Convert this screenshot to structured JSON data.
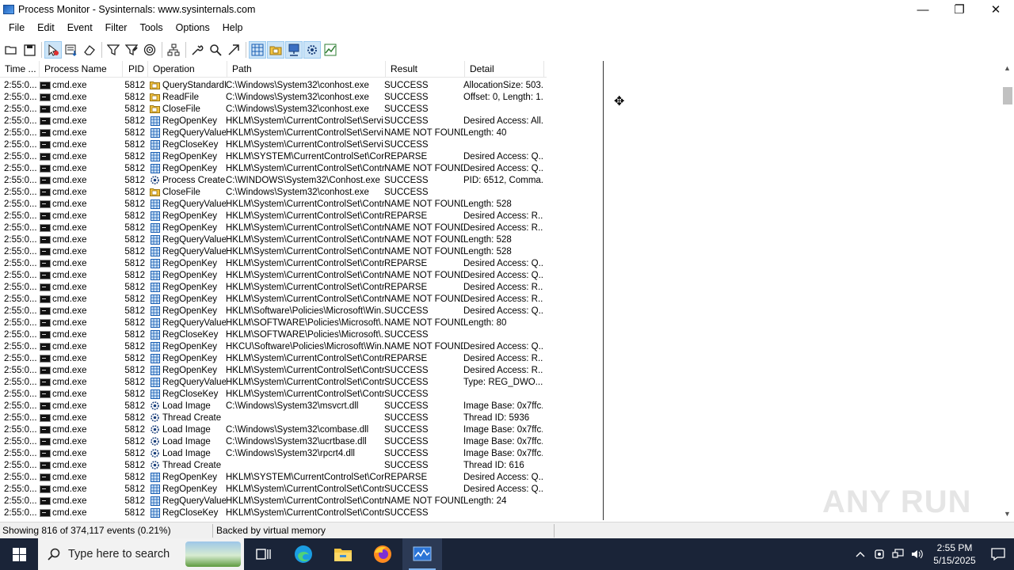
{
  "window": {
    "title": "Process Monitor - Sysinternals: www.sysinternals.com",
    "minimize": "—",
    "maximize": "❐",
    "close": "✕"
  },
  "menu": [
    "File",
    "Edit",
    "Event",
    "Filter",
    "Tools",
    "Options",
    "Help"
  ],
  "columns": [
    "Time ...",
    "Process Name",
    "PID",
    "Operation",
    "Path",
    "Result",
    "Detail"
  ],
  "events": [
    {
      "time": "2:55:0...",
      "process": "cmd.exe",
      "pid": "5812",
      "op_icon": "folder-icon",
      "operation": "QueryStandardI...",
      "path": "C:\\Windows\\System32\\conhost.exe",
      "result": "SUCCESS",
      "detail": "AllocationSize: 503..."
    },
    {
      "time": "2:55:0...",
      "process": "cmd.exe",
      "pid": "5812",
      "op_icon": "folder-icon",
      "operation": "ReadFile",
      "path": "C:\\Windows\\System32\\conhost.exe",
      "result": "SUCCESS",
      "detail": "Offset: 0, Length: 1..."
    },
    {
      "time": "2:55:0...",
      "process": "cmd.exe",
      "pid": "5812",
      "op_icon": "folder-icon",
      "operation": "CloseFile",
      "path": "C:\\Windows\\System32\\conhost.exe",
      "result": "SUCCESS",
      "detail": ""
    },
    {
      "time": "2:55:0...",
      "process": "cmd.exe",
      "pid": "5812",
      "op_icon": "registry-icon",
      "operation": "RegOpenKey",
      "path": "HKLM\\System\\CurrentControlSet\\Servi...",
      "result": "SUCCESS",
      "detail": "Desired Access: All..."
    },
    {
      "time": "2:55:0...",
      "process": "cmd.exe",
      "pid": "5812",
      "op_icon": "registry-icon",
      "operation": "RegQueryValue",
      "path": "HKLM\\System\\CurrentControlSet\\Servi...",
      "result": "NAME NOT FOUND",
      "detail": "Length: 40"
    },
    {
      "time": "2:55:0...",
      "process": "cmd.exe",
      "pid": "5812",
      "op_icon": "registry-icon",
      "operation": "RegCloseKey",
      "path": "HKLM\\System\\CurrentControlSet\\Servi...",
      "result": "SUCCESS",
      "detail": ""
    },
    {
      "time": "2:55:0...",
      "process": "cmd.exe",
      "pid": "5812",
      "op_icon": "registry-icon",
      "operation": "RegOpenKey",
      "path": "HKLM\\SYSTEM\\CurrentControlSet\\Con...",
      "result": "REPARSE",
      "detail": "Desired Access: Q..."
    },
    {
      "time": "2:55:0...",
      "process": "cmd.exe",
      "pid": "5812",
      "op_icon": "registry-icon",
      "operation": "RegOpenKey",
      "path": "HKLM\\System\\CurrentControlSet\\Contr...",
      "result": "NAME NOT FOUND",
      "detail": "Desired Access: Q..."
    },
    {
      "time": "2:55:0...",
      "process": "cmd.exe",
      "pid": "5812",
      "op_icon": "process-icon",
      "operation": "Process Create",
      "path": "C:\\WINDOWS\\System32\\Conhost.exe",
      "result": "SUCCESS",
      "detail": "PID: 6512, Comma..."
    },
    {
      "time": "2:55:0...",
      "process": "cmd.exe",
      "pid": "5812",
      "op_icon": "folder-icon",
      "operation": "CloseFile",
      "path": "C:\\Windows\\System32\\conhost.exe",
      "result": "SUCCESS",
      "detail": ""
    },
    {
      "time": "2:55:0...",
      "process": "cmd.exe",
      "pid": "5812",
      "op_icon": "registry-icon",
      "operation": "RegQueryValue",
      "path": "HKLM\\System\\CurrentControlSet\\Contr...",
      "result": "NAME NOT FOUND",
      "detail": "Length: 528"
    },
    {
      "time": "2:55:0...",
      "process": "cmd.exe",
      "pid": "5812",
      "op_icon": "registry-icon",
      "operation": "RegOpenKey",
      "path": "HKLM\\System\\CurrentControlSet\\Contr...",
      "result": "REPARSE",
      "detail": "Desired Access: R..."
    },
    {
      "time": "2:55:0...",
      "process": "cmd.exe",
      "pid": "5812",
      "op_icon": "registry-icon",
      "operation": "RegOpenKey",
      "path": "HKLM\\System\\CurrentControlSet\\Contr...",
      "result": "NAME NOT FOUND",
      "detail": "Desired Access: R..."
    },
    {
      "time": "2:55:0...",
      "process": "cmd.exe",
      "pid": "5812",
      "op_icon": "registry-icon",
      "operation": "RegQueryValue",
      "path": "HKLM\\System\\CurrentControlSet\\Contr...",
      "result": "NAME NOT FOUND",
      "detail": "Length: 528"
    },
    {
      "time": "2:55:0...",
      "process": "cmd.exe",
      "pid": "5812",
      "op_icon": "registry-icon",
      "operation": "RegQueryValue",
      "path": "HKLM\\System\\CurrentControlSet\\Contr...",
      "result": "NAME NOT FOUND",
      "detail": "Length: 528"
    },
    {
      "time": "2:55:0...",
      "process": "cmd.exe",
      "pid": "5812",
      "op_icon": "registry-icon",
      "operation": "RegOpenKey",
      "path": "HKLM\\System\\CurrentControlSet\\Contr...",
      "result": "REPARSE",
      "detail": "Desired Access: Q..."
    },
    {
      "time": "2:55:0...",
      "process": "cmd.exe",
      "pid": "5812",
      "op_icon": "registry-icon",
      "operation": "RegOpenKey",
      "path": "HKLM\\System\\CurrentControlSet\\Contr...",
      "result": "NAME NOT FOUND",
      "detail": "Desired Access: Q..."
    },
    {
      "time": "2:55:0...",
      "process": "cmd.exe",
      "pid": "5812",
      "op_icon": "registry-icon",
      "operation": "RegOpenKey",
      "path": "HKLM\\System\\CurrentControlSet\\Contr...",
      "result": "REPARSE",
      "detail": "Desired Access: R..."
    },
    {
      "time": "2:55:0...",
      "process": "cmd.exe",
      "pid": "5812",
      "op_icon": "registry-icon",
      "operation": "RegOpenKey",
      "path": "HKLM\\System\\CurrentControlSet\\Contr...",
      "result": "NAME NOT FOUND",
      "detail": "Desired Access: R..."
    },
    {
      "time": "2:55:0...",
      "process": "cmd.exe",
      "pid": "5812",
      "op_icon": "registry-icon",
      "operation": "RegOpenKey",
      "path": "HKLM\\Software\\Policies\\Microsoft\\Win...",
      "result": "SUCCESS",
      "detail": "Desired Access: Q..."
    },
    {
      "time": "2:55:0...",
      "process": "cmd.exe",
      "pid": "5812",
      "op_icon": "registry-icon",
      "operation": "RegQueryValue",
      "path": "HKLM\\SOFTWARE\\Policies\\Microsoft\\...",
      "result": "NAME NOT FOUND",
      "detail": "Length: 80"
    },
    {
      "time": "2:55:0...",
      "process": "cmd.exe",
      "pid": "5812",
      "op_icon": "registry-icon",
      "operation": "RegCloseKey",
      "path": "HKLM\\SOFTWARE\\Policies\\Microsoft\\...",
      "result": "SUCCESS",
      "detail": ""
    },
    {
      "time": "2:55:0...",
      "process": "cmd.exe",
      "pid": "5812",
      "op_icon": "registry-icon",
      "operation": "RegOpenKey",
      "path": "HKCU\\Software\\Policies\\Microsoft\\Win...",
      "result": "NAME NOT FOUND",
      "detail": "Desired Access: Q..."
    },
    {
      "time": "2:55:0...",
      "process": "cmd.exe",
      "pid": "5812",
      "op_icon": "registry-icon",
      "operation": "RegOpenKey",
      "path": "HKLM\\System\\CurrentControlSet\\Contr...",
      "result": "REPARSE",
      "detail": "Desired Access: R..."
    },
    {
      "time": "2:55:0...",
      "process": "cmd.exe",
      "pid": "5812",
      "op_icon": "registry-icon",
      "operation": "RegOpenKey",
      "path": "HKLM\\System\\CurrentControlSet\\Contr...",
      "result": "SUCCESS",
      "detail": "Desired Access: R..."
    },
    {
      "time": "2:55:0...",
      "process": "cmd.exe",
      "pid": "5812",
      "op_icon": "registry-icon",
      "operation": "RegQueryValue",
      "path": "HKLM\\System\\CurrentControlSet\\Contr...",
      "result": "SUCCESS",
      "detail": "Type: REG_DWO..."
    },
    {
      "time": "2:55:0...",
      "process": "cmd.exe",
      "pid": "5812",
      "op_icon": "registry-icon",
      "operation": "RegCloseKey",
      "path": "HKLM\\System\\CurrentControlSet\\Contr...",
      "result": "SUCCESS",
      "detail": ""
    },
    {
      "time": "2:55:0...",
      "process": "cmd.exe",
      "pid": "5812",
      "op_icon": "process-icon",
      "operation": "Load Image",
      "path": "C:\\Windows\\System32\\msvcrt.dll",
      "result": "SUCCESS",
      "detail": "Image Base: 0x7ffc..."
    },
    {
      "time": "2:55:0...",
      "process": "cmd.exe",
      "pid": "5812",
      "op_icon": "process-icon",
      "operation": "Thread Create",
      "path": "",
      "result": "SUCCESS",
      "detail": "Thread ID: 5936"
    },
    {
      "time": "2:55:0...",
      "process": "cmd.exe",
      "pid": "5812",
      "op_icon": "process-icon",
      "operation": "Load Image",
      "path": "C:\\Windows\\System32\\combase.dll",
      "result": "SUCCESS",
      "detail": "Image Base: 0x7ffc..."
    },
    {
      "time": "2:55:0...",
      "process": "cmd.exe",
      "pid": "5812",
      "op_icon": "process-icon",
      "operation": "Load Image",
      "path": "C:\\Windows\\System32\\ucrtbase.dll",
      "result": "SUCCESS",
      "detail": "Image Base: 0x7ffc..."
    },
    {
      "time": "2:55:0...",
      "process": "cmd.exe",
      "pid": "5812",
      "op_icon": "process-icon",
      "operation": "Load Image",
      "path": "C:\\Windows\\System32\\rpcrt4.dll",
      "result": "SUCCESS",
      "detail": "Image Base: 0x7ffc..."
    },
    {
      "time": "2:55:0...",
      "process": "cmd.exe",
      "pid": "5812",
      "op_icon": "process-icon",
      "operation": "Thread Create",
      "path": "",
      "result": "SUCCESS",
      "detail": "Thread ID: 616"
    },
    {
      "time": "2:55:0...",
      "process": "cmd.exe",
      "pid": "5812",
      "op_icon": "registry-icon",
      "operation": "RegOpenKey",
      "path": "HKLM\\SYSTEM\\CurrentControlSet\\Con...",
      "result": "REPARSE",
      "detail": "Desired Access: Q..."
    },
    {
      "time": "2:55:0...",
      "process": "cmd.exe",
      "pid": "5812",
      "op_icon": "registry-icon",
      "operation": "RegOpenKey",
      "path": "HKLM\\System\\CurrentControlSet\\Contr...",
      "result": "SUCCESS",
      "detail": "Desired Access: Q..."
    },
    {
      "time": "2:55:0...",
      "process": "cmd.exe",
      "pid": "5812",
      "op_icon": "registry-icon",
      "operation": "RegQueryValue",
      "path": "HKLM\\System\\CurrentControlSet\\Contr...",
      "result": "NAME NOT FOUND",
      "detail": "Length: 24"
    },
    {
      "time": "2:55:0...",
      "process": "cmd.exe",
      "pid": "5812",
      "op_icon": "registry-icon",
      "operation": "RegCloseKey",
      "path": "HKLM\\System\\CurrentControlSet\\Contr...",
      "result": "SUCCESS",
      "detail": ""
    }
  ],
  "status": {
    "showing": "Showing 816 of 374,117 events (0.21%)",
    "backing": "Backed by virtual memory"
  },
  "watermark": "ANY RUN",
  "taskbar": {
    "search_placeholder": "Type here to search",
    "time": "2:55 PM",
    "date": "5/15/2025"
  },
  "colors": {
    "taskbar_bg": "#1a2438",
    "toolbar_active": "#cce4f7"
  }
}
